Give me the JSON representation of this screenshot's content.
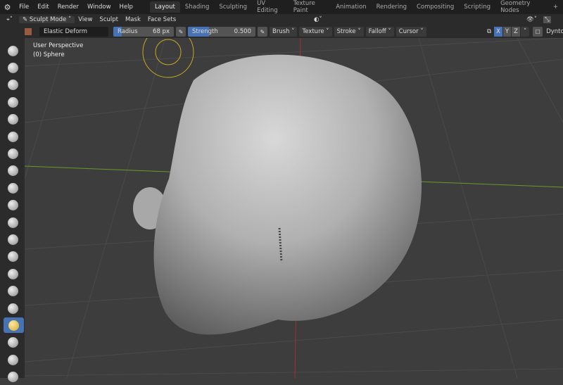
{
  "menubar": {
    "items": [
      "File",
      "Edit",
      "Render",
      "Window",
      "Help"
    ],
    "workspaces": [
      "Layout",
      "Shading",
      "Sculpting",
      "UV Editing",
      "Texture Paint",
      "Animation",
      "Rendering",
      "Compositing",
      "Scripting",
      "Geometry Nodes",
      "+"
    ],
    "active_workspace": "Layout"
  },
  "header": {
    "mode": "Sculpt Mode",
    "menus": [
      "View",
      "Sculpt",
      "Mask",
      "Face Sets"
    ]
  },
  "tool_settings": {
    "brush_name": "Elastic Deform",
    "radius_label": "Radius",
    "radius_value": "68 px",
    "strength_label": "Strength",
    "strength_value": "0.500",
    "strength_fraction": 0.5,
    "dropdowns": [
      "Brush",
      "Texture",
      "Stroke",
      "Falloff",
      "Cursor"
    ],
    "axes": [
      "X",
      "Y",
      "Z"
    ],
    "active_axes": [
      "X"
    ],
    "dyntopo_label": "Dyntopo"
  },
  "viewport": {
    "perspective": "User Perspective",
    "object": "(0) Sphere"
  },
  "toolbar": {
    "tool_count": 20,
    "active_index": 16
  },
  "colors": {
    "accent": "#4772b3",
    "brush_cursor": "#c8a820",
    "x_axis": "#a0303a",
    "y_axis": "#6a9a2a"
  }
}
